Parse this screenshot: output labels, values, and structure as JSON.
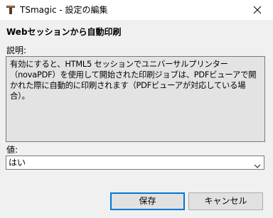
{
  "window": {
    "title": "TSmagic - 設定の編集",
    "app_icon": "tsmagic-app-icon",
    "close_icon": "close-icon"
  },
  "setting": {
    "heading": "Webセッションから自動印刷",
    "description_label": "説明:",
    "description": "有効にすると、HTML5 セッションでユニバーサルプリンター（novaPDF）を使用して開始された印刷ジョブは、PDFビューアで開かれた際に自動的に印刷されます（PDFビューアが対応している場合）。",
    "value_label": "値:",
    "value": "はい"
  },
  "buttons": {
    "save": "保存",
    "cancel": "キャンセル"
  }
}
